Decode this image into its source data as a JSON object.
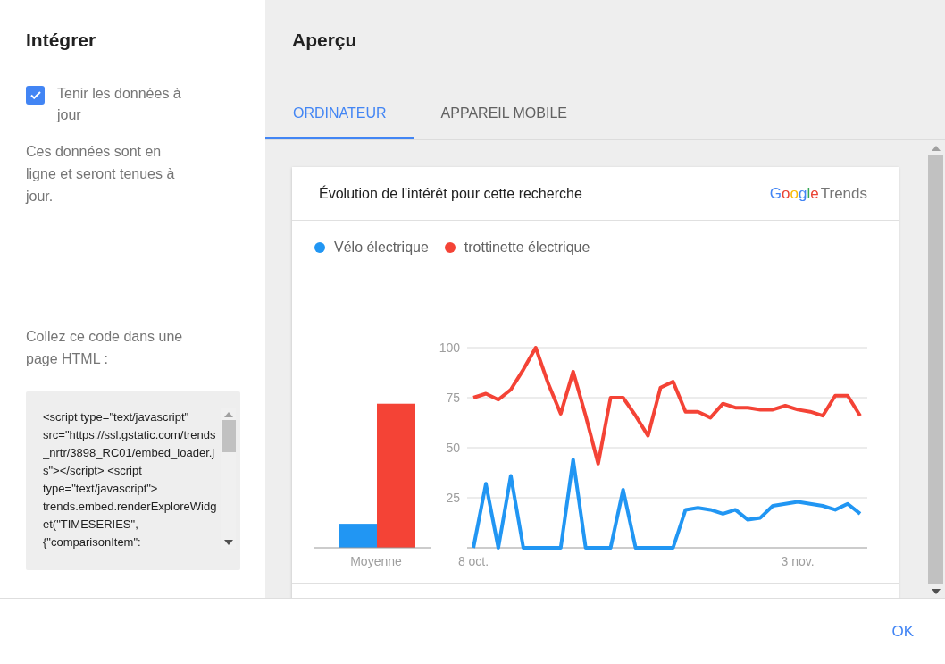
{
  "embed_panel": {
    "title": "Intégrer",
    "keep_updated": {
      "label": "Tenir les données à jour",
      "checked": true
    },
    "description": "Ces données sont en ligne et seront tenues à jour.",
    "code_label": "Collez ce code dans une page HTML :",
    "code": "<script type=\"text/javascript\" src=\"https://ssl.gstatic.com/trends_nrtr/3898_RC01/embed_loader.js\"></script> <script type=\"text/javascript\"> trends.embed.renderExploreWidget(\"TIMESERIES\", {\"comparisonItem\":"
  },
  "preview": {
    "title": "Aperçu",
    "tabs": [
      {
        "label": "ORDINATEUR",
        "selected": true
      },
      {
        "label": "APPAREIL MOBILE",
        "selected": false
      }
    ],
    "card": {
      "title": "Évolution de l'intérêt pour cette recherche",
      "logo": {
        "brand": "Google",
        "product": "Trends"
      },
      "average_chart": {
        "chart_data": {
          "type": "bar",
          "categories": [
            "Moyenne"
          ],
          "ylim": [
            0,
            100
          ],
          "series": [
            {
              "color": "#2196f3",
              "values": [
                12
              ]
            },
            {
              "color": "#f44336",
              "values": [
                72
              ]
            }
          ]
        }
      },
      "trend_chart": {
        "chart_data": {
          "type": "line",
          "categories": [
            "8 oct.",
            null,
            null,
            null,
            null,
            null,
            null,
            null,
            null,
            null,
            null,
            null,
            null,
            null,
            null,
            null,
            null,
            null,
            null,
            null,
            null,
            null,
            null,
            null,
            null,
            null,
            "3 nov.",
            null,
            null,
            null,
            null,
            null
          ],
          "ylim": [
            0,
            100
          ],
          "yticks": [
            25,
            50,
            75,
            100
          ],
          "grid": true,
          "series": [
            {
              "name": "Vélo électrique",
              "color": "#2196f3",
              "values": [
                0,
                32,
                0,
                36,
                0,
                0,
                0,
                0,
                44,
                0,
                0,
                0,
                29,
                0,
                0,
                0,
                0,
                19,
                20,
                19,
                17,
                19,
                14,
                15,
                21,
                22,
                23,
                22,
                21,
                19,
                22,
                17
              ]
            },
            {
              "name": "trottinette électrique",
              "color": "#f44336",
              "values": [
                75,
                77,
                74,
                79,
                89,
                100,
                82,
                67,
                88,
                66,
                42,
                75,
                75,
                66,
                56,
                80,
                83,
                68,
                68,
                65,
                72,
                70,
                70,
                69,
                69,
                71,
                69,
                68,
                66,
                76,
                76,
                66
              ]
            }
          ]
        }
      }
    }
  },
  "footer": {
    "ok_button": "OK"
  }
}
